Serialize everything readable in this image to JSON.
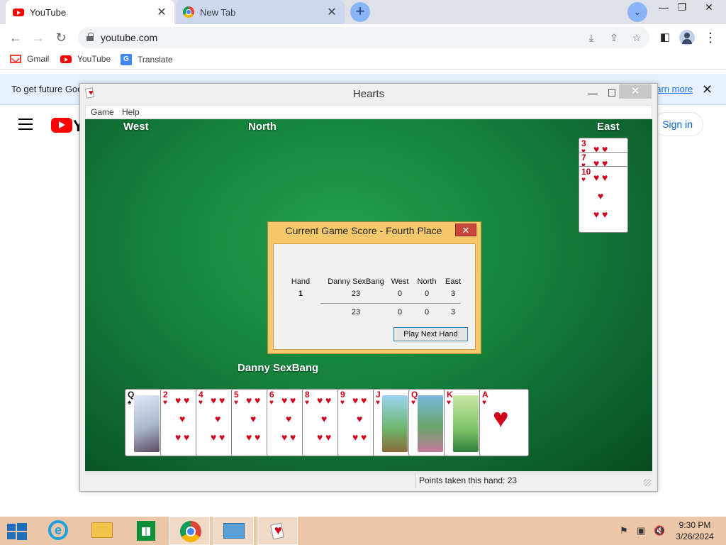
{
  "browser": {
    "tabs": [
      {
        "title": "YouTube",
        "icon": "youtube-icon",
        "active": true
      },
      {
        "title": "New Tab",
        "icon": "chrome-icon",
        "active": false
      }
    ],
    "new_tab_symbol": "+",
    "url": "youtube.com",
    "bookmarks": [
      {
        "label": "Gmail",
        "icon": "gmail-icon"
      },
      {
        "label": "YouTube",
        "icon": "youtube-icon"
      },
      {
        "label": "Translate",
        "icon": "translate-icon"
      }
    ],
    "infobar": {
      "text": "To get future Goo",
      "link": "earn more"
    },
    "page": {
      "wordmark": "Y",
      "sign_in": "Sign in"
    }
  },
  "hearts": {
    "window_title": "Hearts",
    "menu": [
      "Game",
      "Help"
    ],
    "players": {
      "west": "West",
      "north": "North",
      "east": "East",
      "south": "Danny SexBang"
    },
    "east_cards": [
      {
        "rank": "3",
        "suit": "hearts"
      },
      {
        "rank": "7",
        "suit": "hearts"
      },
      {
        "rank": "10",
        "suit": "hearts"
      }
    ],
    "hand": [
      {
        "rank": "Q",
        "suit": "spades"
      },
      {
        "rank": "2",
        "suit": "hearts"
      },
      {
        "rank": "4",
        "suit": "hearts"
      },
      {
        "rank": "5",
        "suit": "hearts"
      },
      {
        "rank": "6",
        "suit": "hearts"
      },
      {
        "rank": "8",
        "suit": "hearts"
      },
      {
        "rank": "9",
        "suit": "hearts"
      },
      {
        "rank": "J",
        "suit": "hearts"
      },
      {
        "rank": "Q",
        "suit": "hearts"
      },
      {
        "rank": "K",
        "suit": "hearts"
      },
      {
        "rank": "A",
        "suit": "hearts"
      }
    ],
    "score_dialog": {
      "title": "Current Game Score - Fourth Place",
      "headers": [
        "Hand",
        "Danny SexBang",
        "West",
        "North",
        "East"
      ],
      "rows": [
        [
          "1",
          "23",
          "0",
          "0",
          "3"
        ]
      ],
      "totals": [
        "23",
        "0",
        "0",
        "3"
      ],
      "button": "Play Next Hand"
    },
    "status": "Points taken this hand: 23"
  },
  "taskbar": {
    "time": "9:30 PM",
    "date": "3/26/2024"
  }
}
